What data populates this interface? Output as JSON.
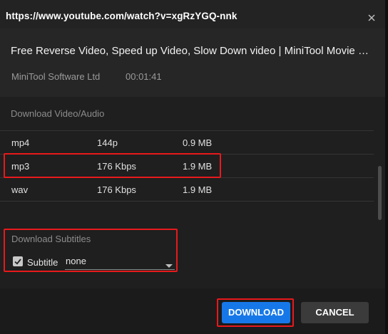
{
  "dialog": {
    "url": "https://www.youtube.com/watch?v=xgRzYGQ-nnk",
    "close_icon": "close-icon"
  },
  "video": {
    "title": "Free Reverse Video, Speed up Video, Slow Down video | MiniTool Movie Maker Tutorial",
    "channel": "MiniTool Software Ltd",
    "duration": "00:01:41"
  },
  "download": {
    "section_title": "Download Video/Audio",
    "rows": [
      {
        "format": "mp4",
        "quality": "144p",
        "size": "0.9 MB"
      },
      {
        "format": "mp3",
        "quality": "176 Kbps",
        "size": "1.9 MB"
      },
      {
        "format": "wav",
        "quality": "176 Kbps",
        "size": "1.9 MB"
      }
    ],
    "selected_row": 1
  },
  "subtitles": {
    "section_title": "Download Subtitles",
    "checkbox_label": "Subtitle",
    "checked": true,
    "selected_value": "none"
  },
  "buttons": {
    "download_label": "DOWNLOAD",
    "cancel_label": "CANCEL"
  },
  "colors": {
    "accent": "#1678e8",
    "highlight": "#e8191c",
    "background": "#1f1f1f"
  }
}
